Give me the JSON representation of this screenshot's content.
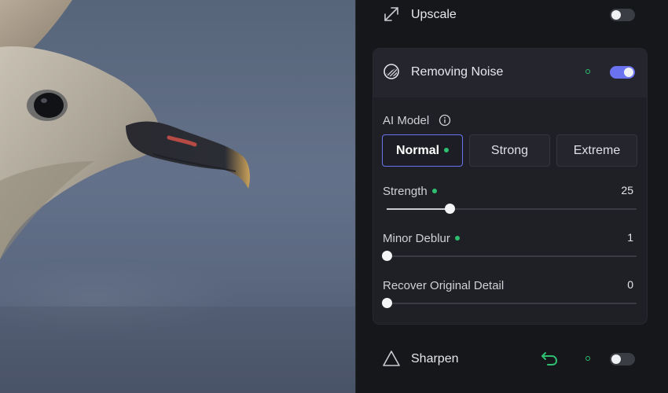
{
  "upscale": {
    "label": "Upscale",
    "icon": "expand-icon",
    "enabled": false
  },
  "noise": {
    "label": "Removing Noise",
    "icon": "noise-icon",
    "enabled": true,
    "ai_model": {
      "label": "AI Model",
      "options": [
        "Normal",
        "Strong",
        "Extreme"
      ],
      "selected": "Normal"
    },
    "sliders": {
      "strength": {
        "label": "Strength",
        "value": "25",
        "fraction": 0.25
      },
      "deblur": {
        "label": "Minor Deblur",
        "value": "1",
        "fraction": 0.0
      },
      "detail": {
        "label": "Recover Original Detail",
        "value": "0",
        "fraction": 0.0
      }
    }
  },
  "sharpen": {
    "label": "Sharpen",
    "icon": "triangle-icon",
    "enabled": false
  },
  "colors": {
    "accent": "#6b72ef",
    "status_green": "#2fbf71"
  }
}
